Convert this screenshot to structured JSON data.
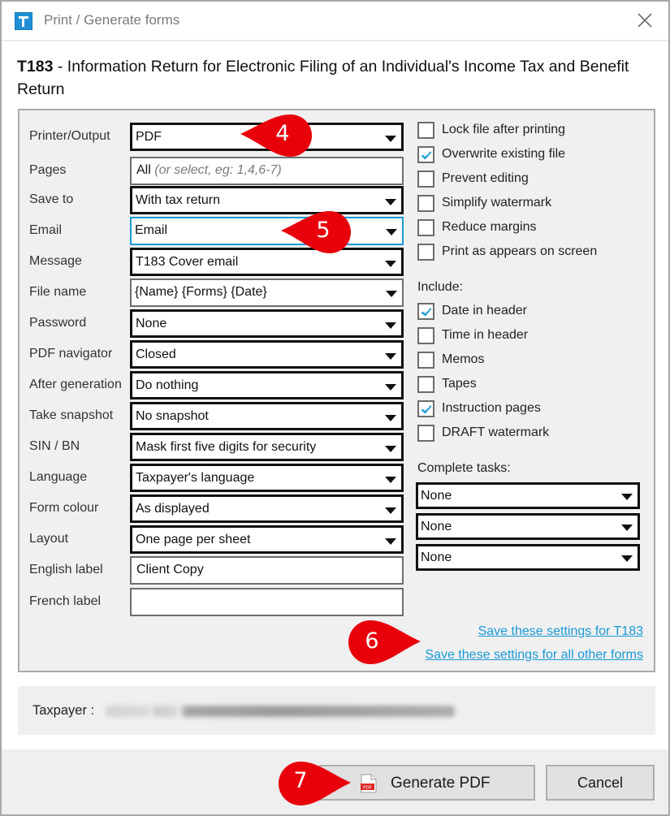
{
  "window": {
    "title": "Print / Generate forms",
    "close_icon": "close-icon",
    "app_icon": "taxcycle-app-icon"
  },
  "heading": {
    "form_code": "T183",
    "form_title": " - Information Return for Electronic Filing of an Individual's Income Tax and Benefit Return"
  },
  "fields": [
    {
      "label": "Printer/Output",
      "value": "PDF",
      "type": "select"
    },
    {
      "label": "Pages",
      "value": "All",
      "hint": "(or select, eg: 1,4,6-7)",
      "type": "input"
    },
    {
      "label": "Save to",
      "value": "With tax return",
      "type": "select"
    },
    {
      "label": "Email",
      "value": "Email",
      "type": "select",
      "focused": true
    },
    {
      "label": "Message",
      "value": "T183 Cover email",
      "type": "select"
    },
    {
      "label": "File name",
      "value": "{Name} {Forms} {Date}",
      "type": "select"
    },
    {
      "label": "Password",
      "value": "None",
      "type": "select"
    },
    {
      "label": "PDF navigator",
      "value": "Closed",
      "type": "select"
    },
    {
      "label": "After generation",
      "value": "Do nothing",
      "type": "select"
    },
    {
      "label": "Take snapshot",
      "value": "No snapshot",
      "type": "select"
    },
    {
      "label": "SIN / BN",
      "value": "Mask first five digits for security",
      "type": "select"
    },
    {
      "label": "Language",
      "value": "Taxpayer's language",
      "type": "select"
    },
    {
      "label": "Form colour",
      "value": "As displayed",
      "type": "select"
    },
    {
      "label": "Layout",
      "value": "One page per sheet",
      "type": "select"
    },
    {
      "label": "English label",
      "value": "Client Copy",
      "type": "input"
    },
    {
      "label": "French label",
      "value": "",
      "type": "input"
    }
  ],
  "options": [
    {
      "label": "Lock file after printing",
      "checked": false
    },
    {
      "label": "Overwrite existing file",
      "checked": true
    },
    {
      "label": "Prevent editing",
      "checked": false
    },
    {
      "label": "Simplify watermark",
      "checked": false
    },
    {
      "label": "Reduce margins",
      "checked": false
    },
    {
      "label": "Print as appears on screen",
      "checked": false
    }
  ],
  "include": {
    "label": "Include:",
    "items": [
      {
        "label": "Date in header",
        "checked": true
      },
      {
        "label": "Time in header",
        "checked": false
      },
      {
        "label": "Memos",
        "checked": false
      },
      {
        "label": "Tapes",
        "checked": false
      },
      {
        "label": "Instruction pages",
        "checked": true
      },
      {
        "label": "DRAFT watermark",
        "checked": false
      }
    ]
  },
  "complete_tasks": {
    "label": "Complete tasks:",
    "selects": [
      "None",
      "None",
      "None"
    ]
  },
  "links": {
    "save_form": "Save these settings for T183",
    "save_all": "Save these settings for all other forms"
  },
  "taxpayer": {
    "label": "Taxpayer :",
    "value_obscured": true
  },
  "buttons": {
    "generate": "Generate PDF",
    "generate_icon": "pdf-file-icon",
    "cancel": "Cancel"
  },
  "callouts": [
    "4",
    "5",
    "6",
    "7"
  ],
  "colors": {
    "accent": "#1a9ad6",
    "callout": "#e8000b",
    "panel_bg": "#f0f0f0"
  }
}
